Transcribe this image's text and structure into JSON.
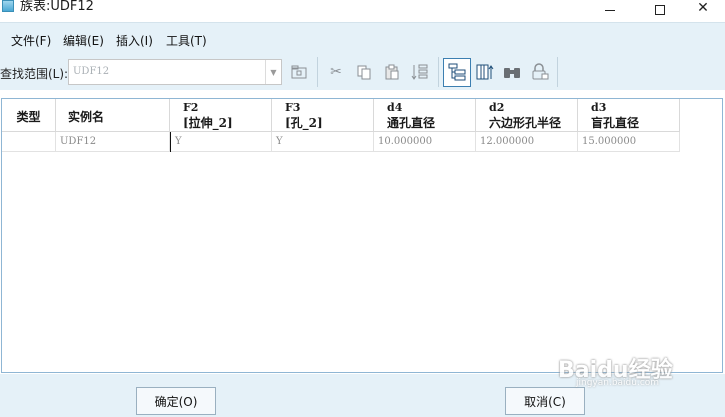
{
  "window": {
    "title": "族表:UDF12",
    "minimize": "–",
    "close": "✕"
  },
  "menu": {
    "file": "文件(F)",
    "edit": "编辑(E)",
    "insert": "插入(I)",
    "tools": "工具(T)"
  },
  "toolbar": {
    "scope_label": "查找范围(L):",
    "scope_value": "UDF12",
    "icons": [
      "open-folder-icon",
      "cut-icon",
      "copy-icon",
      "paste-icon",
      "fill-down-icon",
      "tree-structure-icon",
      "insert-column-icon",
      "binoculars-icon",
      "lock-icon"
    ]
  },
  "table": {
    "headers": [
      {
        "line1": "类型"
      },
      {
        "line1": "实例名"
      },
      {
        "line1": "F2",
        "line2": "[拉伸_2]"
      },
      {
        "line1": "F3",
        "line2": "[孔_2]"
      },
      {
        "line1": "d4",
        "line2": "通孔直径"
      },
      {
        "line1": "d2",
        "line2": "六边形孔半径"
      },
      {
        "line1": "d3",
        "line2": "盲孔直径"
      }
    ],
    "rows": [
      [
        "",
        "UDF12",
        "Y",
        "Y",
        "10.000000",
        "12.000000",
        "15.000000"
      ]
    ]
  },
  "footer": {
    "ok_label": "确定(O)",
    "cancel_label": "取消(C)"
  },
  "watermark": {
    "text": "Baidu经验",
    "sub": "jingyan.baidu.com"
  },
  "colors": {
    "toolbar_bg": "#e5f1f8",
    "panel_border": "#8fb6d4",
    "pressed_border": "#3c7fb1"
  }
}
